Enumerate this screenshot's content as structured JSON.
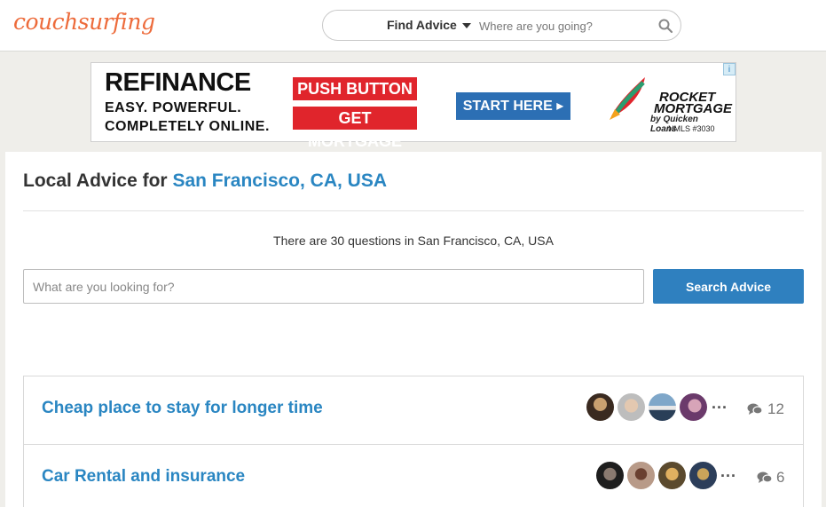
{
  "header": {
    "logo_text": "couchsurfing",
    "find_advice_label": "Find Advice",
    "search_placeholder": "Where are you going?"
  },
  "ad": {
    "headline": "REFINANCE",
    "line2": "EASY. POWERFUL.",
    "line3": "COMPLETELY ONLINE.",
    "button1": "PUSH BUTTON",
    "button2": "GET MORTGAGE",
    "cta": "START HERE",
    "brand_line1": "ROCKET",
    "brand_line2": "MORTGAGE",
    "brand_line3": "by Quicken Loans",
    "nmls": "NMLS #3030",
    "info_icon": "i"
  },
  "page": {
    "title_prefix": "Local Advice for",
    "location": "San Francisco, CA, USA",
    "question_count_text": "There are 30 questions in San Francisco, CA, USA",
    "advice_placeholder": "What are you looking for?",
    "search_button": "Search Advice"
  },
  "questions": [
    {
      "title": "Cheap place to stay for longer time",
      "more": "...",
      "reply_count": "12"
    },
    {
      "title": "Car Rental and insurance",
      "more": "...",
      "reply_count": "6"
    }
  ],
  "colors": {
    "brand_orange": "#ed6b3b",
    "link_blue": "#2a86c2",
    "button_blue": "#2f80bf",
    "ad_red": "#e0252c",
    "ad_blue": "#2c6fb4"
  }
}
